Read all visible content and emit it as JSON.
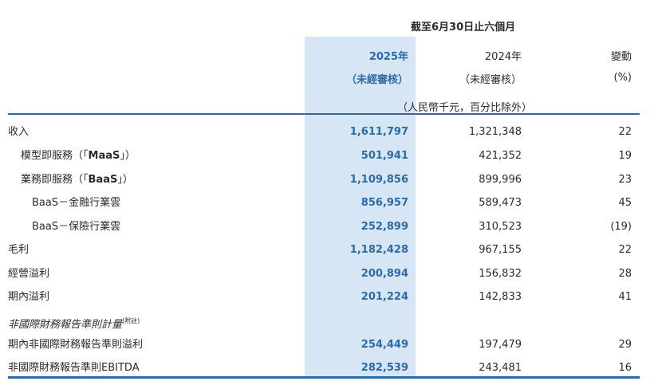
{
  "header": {
    "period": "截至6月30日止六個月",
    "col_2025_year": "2025年",
    "col_2025_note": "（未經審核）",
    "col_2024_year": "2024年",
    "col_2024_note": "（未經審核）",
    "col_change": "變動",
    "col_change_unit": "(%)",
    "unit_note": "（人民幣千元，百分比除外）"
  },
  "rows": [
    {
      "label": "收入",
      "v2025": "1,611,797",
      "v2024": "1,321,348",
      "change": "22"
    },
    {
      "label_pre": "模型即服務（「",
      "label_bold": "MaaS",
      "label_post": "」）",
      "v2025": "501,941",
      "v2024": "421,352",
      "change": "19"
    },
    {
      "label_pre": "業務即服務（「",
      "label_bold": "BaaS",
      "label_post": "」）",
      "v2025": "1,109,856",
      "v2024": "899,996",
      "change": "23"
    },
    {
      "label": "BaaS－金融行業雲",
      "v2025": "856,957",
      "v2024": "589,473",
      "change": "45"
    },
    {
      "label": "BaaS－保險行業雲",
      "v2025": "252,899",
      "v2024": "310,523",
      "change": "(19)"
    },
    {
      "label": "毛利",
      "v2025": "1,182,428",
      "v2024": "967,155",
      "change": "22"
    },
    {
      "label": "經營溢利",
      "v2025": "200,894",
      "v2024": "156,832",
      "change": "28"
    },
    {
      "label": "期內溢利",
      "v2025": "201,224",
      "v2024": "142,833",
      "change": "41"
    },
    {
      "label": "非國際財務報告準則計量",
      "note": "(附註)"
    },
    {
      "label": "期內非國際財務報告準則溢利",
      "v2025": "254,449",
      "v2024": "197,479",
      "change": "29"
    },
    {
      "label": "非國際財務報告準則EBITDA",
      "v2025": "282,539",
      "v2024": "243,481",
      "change": "16"
    }
  ]
}
